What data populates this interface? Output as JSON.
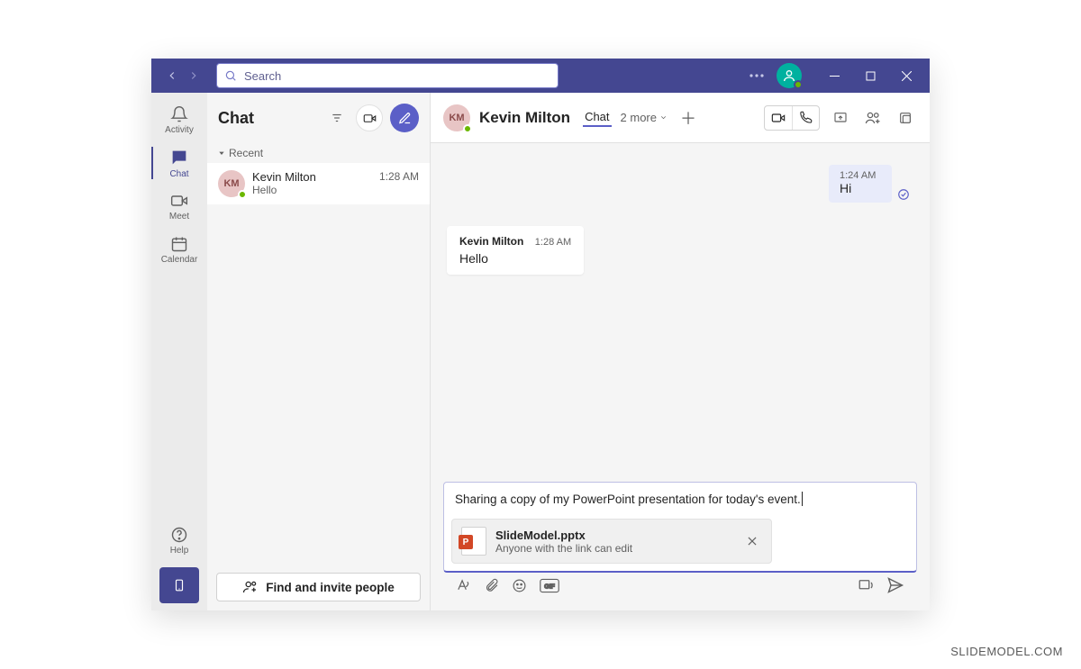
{
  "titlebar": {
    "search_placeholder": "Search"
  },
  "rail": {
    "activity": "Activity",
    "chat": "Chat",
    "meet": "Meet",
    "calendar": "Calendar",
    "help": "Help"
  },
  "list": {
    "title": "Chat",
    "section": "Recent",
    "items": [
      {
        "initials": "KM",
        "name": "Kevin Milton",
        "preview": "Hello",
        "time": "1:28 AM"
      }
    ],
    "invite_label": "Find and invite people"
  },
  "conv": {
    "contact_initials": "KM",
    "contact_name": "Kevin Milton",
    "tab_chat": "Chat",
    "tab_more": "2 more",
    "messages": {
      "mine": {
        "time": "1:24 AM",
        "text": "Hi"
      },
      "theirs": {
        "author": "Kevin Milton",
        "time": "1:28 AM",
        "text": "Hello"
      }
    }
  },
  "compose": {
    "text": "Sharing a copy of my PowerPoint presentation for today's event.",
    "attachment": {
      "badge": "P",
      "name": "SlideModel.pptx",
      "sub": "Anyone with the link can edit"
    }
  },
  "credit": "SLIDEMODEL.COM"
}
